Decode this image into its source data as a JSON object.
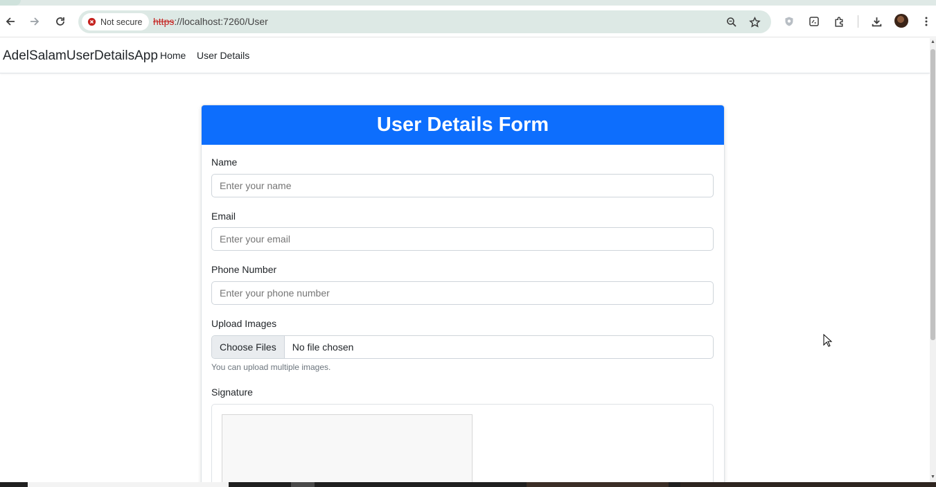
{
  "browser": {
    "security_label": "Not secure",
    "url_scheme": "https",
    "url_rest": "://localhost:7260/User",
    "icons": [
      "back-arrow-icon",
      "forward-arrow-icon",
      "reload-icon",
      "zoom-icon",
      "bookmark-star-icon",
      "shield-extension-icon",
      "console-extension-icon",
      "puzzle-extensions-icon",
      "download-icon",
      "profile-avatar",
      "more-menu-icon"
    ]
  },
  "navbar": {
    "brand": "AdelSalamUserDetailsApp",
    "links": [
      "Home",
      "User Details"
    ]
  },
  "form": {
    "title": "User Details Form",
    "name": {
      "label": "Name",
      "placeholder": "Enter your name"
    },
    "email": {
      "label": "Email",
      "placeholder": "Enter your email"
    },
    "phone": {
      "label": "Phone Number",
      "placeholder": "Enter your phone number"
    },
    "upload": {
      "label": "Upload Images",
      "button": "Choose Files",
      "status": "No file chosen",
      "help": "You can upload multiple images."
    },
    "signature": {
      "label": "Signature"
    }
  },
  "colors": {
    "header_bg": "#0d6efd",
    "security_red": "#c5221f"
  }
}
